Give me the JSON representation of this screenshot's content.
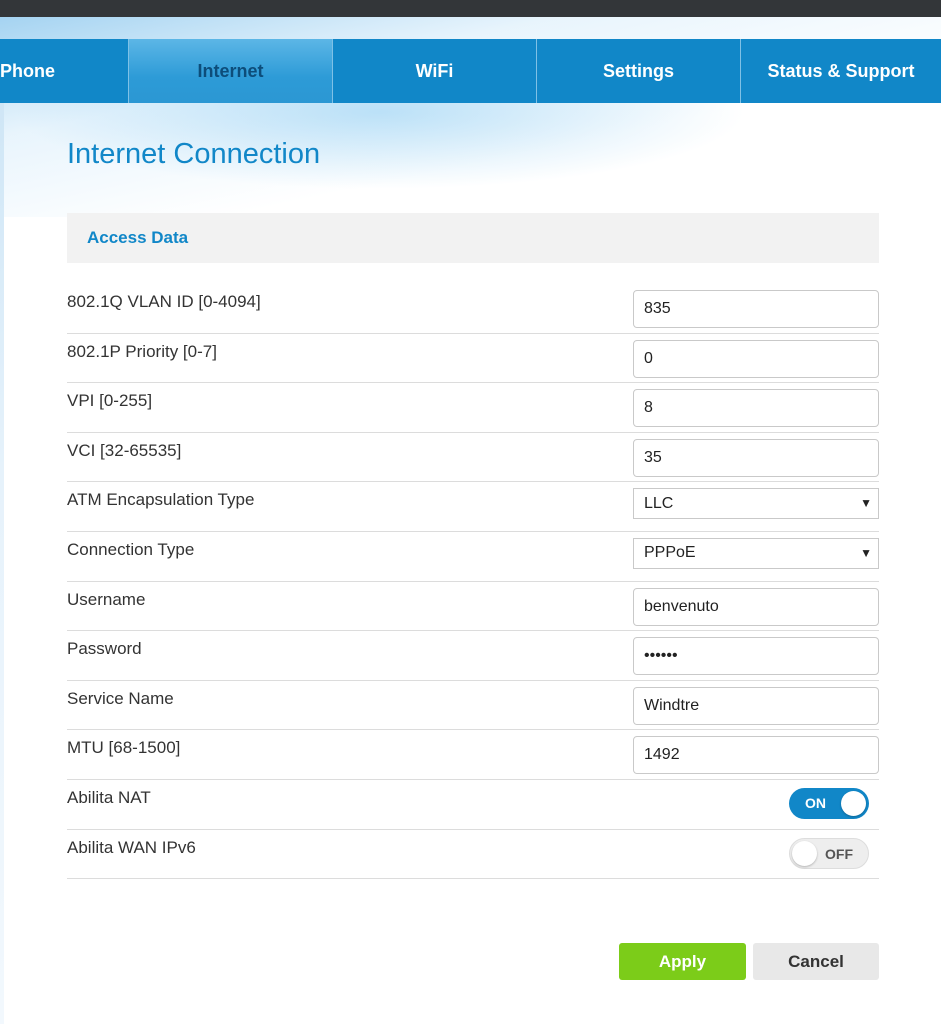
{
  "tabs": [
    {
      "label": "Phone",
      "active": false
    },
    {
      "label": "Internet",
      "active": true
    },
    {
      "label": "WiFi",
      "active": false
    },
    {
      "label": "Settings",
      "active": false
    },
    {
      "label": "Status & Support",
      "active": false
    }
  ],
  "page": {
    "title": "Internet Connection"
  },
  "section": {
    "title": "Access Data"
  },
  "fields": {
    "vlan_id": {
      "label": "802.1Q VLAN ID [0-4094]",
      "value": "835"
    },
    "priority": {
      "label": "802.1P Priority [0-7]",
      "value": "0"
    },
    "vpi": {
      "label": "VPI [0-255]",
      "value": "8"
    },
    "vci": {
      "label": "VCI [32-65535]",
      "value": "35"
    },
    "atm_encapsulation": {
      "label": "ATM Encapsulation Type",
      "value": "LLC"
    },
    "connection_type": {
      "label": "Connection Type",
      "value": "PPPoE"
    },
    "username": {
      "label": "Username",
      "value": "benvenuto"
    },
    "password": {
      "label": "Password",
      "value": "••••••"
    },
    "service_name": {
      "label": "Service Name",
      "value": "Windtre"
    },
    "mtu": {
      "label": "MTU [68-1500]",
      "value": "1492"
    },
    "nat": {
      "label": "Abilita NAT",
      "state": "ON"
    },
    "wan_ipv6": {
      "label": "Abilita WAN IPv6",
      "state": "OFF"
    }
  },
  "buttons": {
    "apply": "Apply",
    "cancel": "Cancel"
  },
  "icons": {
    "select_caret": "caret-down-icon"
  },
  "colors": {
    "primary": "#1187c8",
    "apply": "#7ccc19",
    "cancel": "#e8e8e8"
  }
}
